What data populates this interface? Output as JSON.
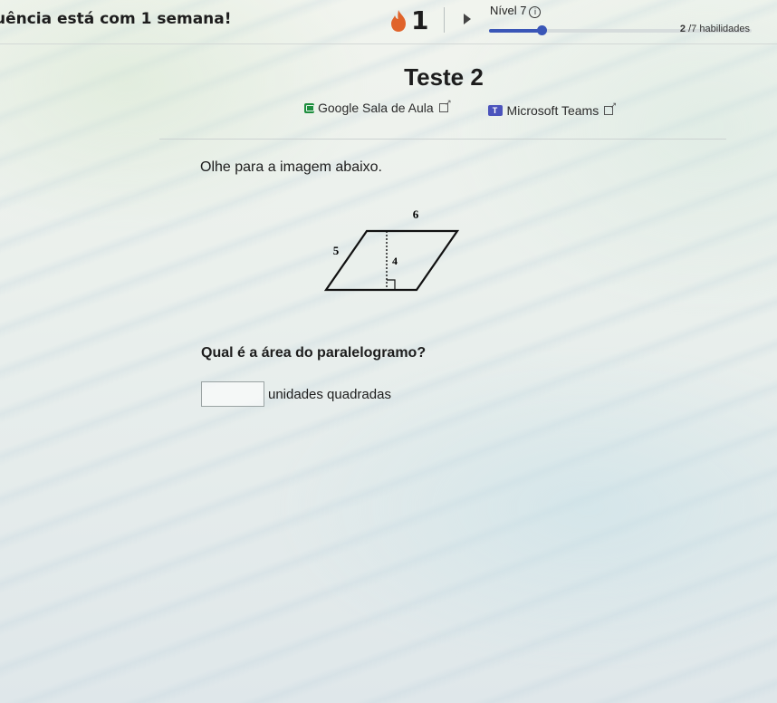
{
  "header": {
    "streak_message": "uência está com 1 semana!",
    "streak_count": "1",
    "level_label": "Nível 7",
    "level_progress": 0.2,
    "skills_done": "2",
    "skills_total": "/7 habilidades",
    "accent_color": "#3a56b7",
    "flame_color": "#e0632a"
  },
  "quiz": {
    "title": "Teste 2",
    "links": [
      {
        "label": "Google Sala de Aula",
        "icon": "google-classroom-icon"
      },
      {
        "label": "Microsoft Teams",
        "icon": "microsoft-teams-icon"
      }
    ],
    "prompt": "Olhe para a imagem abaixo.",
    "figure": {
      "top_label": "6",
      "side_label": "5",
      "height_label": "4"
    },
    "question": "Qual é a área do paralelogramo?",
    "answer_value": "",
    "unit": "unidades quadradas"
  }
}
